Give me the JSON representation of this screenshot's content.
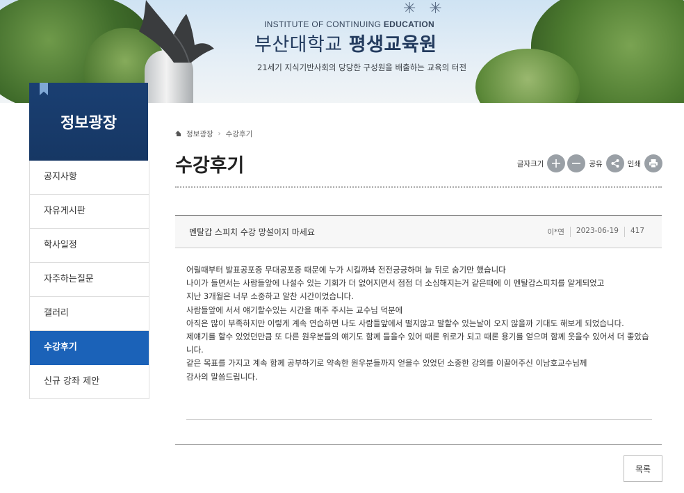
{
  "banner": {
    "subtitle_en_prefix": "INSTITUTE OF CONTINUING",
    "subtitle_en_bold": "EDUCATION",
    "title_univ": "부산대학교",
    "title_inst": "평생교육원",
    "slogan": "21세기 지식기반사회의 당당한 구성원을 배출하는 교육의 터전"
  },
  "sidebar": {
    "title": "정보광장",
    "items": [
      {
        "label": "공지사항"
      },
      {
        "label": "자유게시판"
      },
      {
        "label": "학사일정"
      },
      {
        "label": "자주하는질문"
      },
      {
        "label": "갤러리"
      },
      {
        "label": "수강후기"
      },
      {
        "label": "신규 강좌 제안"
      }
    ],
    "active_index": 5
  },
  "breadcrumb": {
    "level1": "정보광장",
    "level2": "수강후기"
  },
  "page": {
    "title": "수강후기"
  },
  "tools": {
    "font_size_label": "글자크기",
    "share_label": "공유",
    "print_label": "인쇄"
  },
  "post": {
    "title": "멘탈갑 스피치 수강 망설이지 마세요",
    "author": "이*연",
    "date": "2023-06-19",
    "views": "417",
    "body_lines": [
      "어릴때부터 발표공포증 무대공포증 때문에  누가 시킬까봐 전전긍긍하며 늘 뒤로 숨기만 했습니다",
      "나이가 들면서는 사람들앞에 나설수 있는 기회가 더 없어지면서 점점 더 소심해지는거 같은때에 이 멘탈갑스피치를 알게되었고",
      "지난 3개월은 너무 소중하고 알찬 시간이었습니다.",
      "사람들앞에 서서 얘기할수있는 시간을 매주 주시는 교수님 덕분에",
      "아직은 많이 부족하지만 이렇게 계속 연습하면 나도 사람들앞에서 떨지않고 말할수 있는날이 오지 않을까 기대도 해보게 되었습니다.",
      "제얘기를 할수 있었던만큼 또 다른 원우분들의 얘기도 함께 들을수 있어 때론 위로가 되고 때론 용기를 얻으며 함께 웃을수 있어서 더 좋았습니다.",
      "같은 목표를 가지고 계속 함께 공부하기로 약속한 원우분들까지 얻을수 있었던 소중한 강의를 이끌어주신 이남호교수님께",
      "감사의 말씀드립니다."
    ]
  },
  "buttons": {
    "list": "목록"
  }
}
